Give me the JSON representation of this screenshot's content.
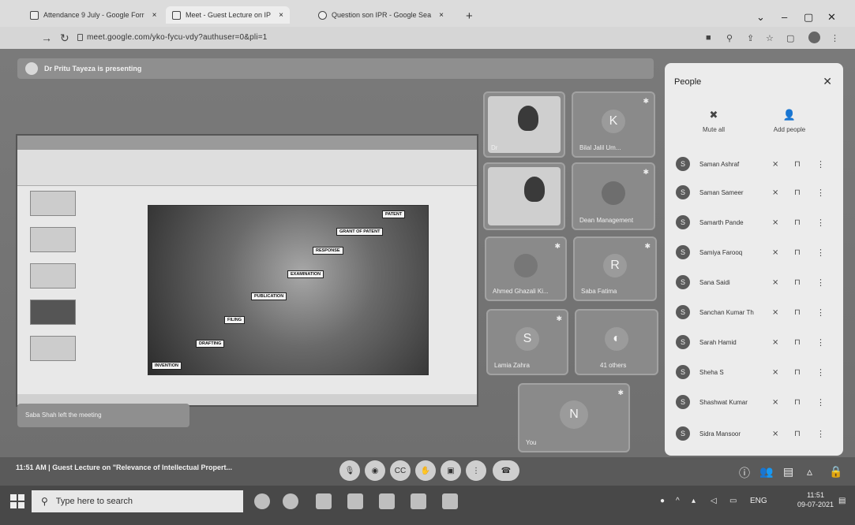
{
  "browser": {
    "tabs": [
      {
        "label": "Attendance 9 July - Google Forr"
      },
      {
        "label": "Meet - Guest Lecture on IP"
      },
      {
        "label": "Question son IPR - Google Sea"
      }
    ],
    "url": "meet.google.com/yko-fycu-vdy?authuser=0&pli=1"
  },
  "meet": {
    "presenting_label": "Dr Pritu Tayeza is presenting",
    "slide": {
      "labels": [
        "PATENT",
        "GRANT OF PATENT",
        "RESPONSE",
        "EXAMINATION",
        "PUBLICATION",
        "FILING",
        "DRAFTING",
        "INVENTION"
      ]
    },
    "tiles": [
      {
        "name": "Dr",
        "initial": ""
      },
      {
        "name": "Bilal Jalil Um...",
        "initial": "K"
      },
      {
        "name": "",
        "initial": ""
      },
      {
        "name": "Dean Management",
        "initial": ""
      },
      {
        "name": "Ahmed Ghazali Ki...",
        "initial": ""
      },
      {
        "name": "Saba Fatima",
        "initial": "R"
      },
      {
        "name": "Lamia Zahra",
        "initial": "S"
      },
      {
        "name": "41 others",
        "initial": ""
      },
      {
        "name": "You",
        "initial": "N"
      }
    ],
    "left_notice": "Saba Shah left the meeting",
    "meeting_info": "11:51 AM  |  Guest Lecture on \"Relevance of Intellectual Propert..."
  },
  "people_panel": {
    "title": "People",
    "mute_all": "Mute all",
    "add_people": "Add people",
    "participants": [
      {
        "name": "Saman Ashraf",
        "initial": "S"
      },
      {
        "name": "Saman Sameer",
        "initial": "S"
      },
      {
        "name": "Samarth Pande",
        "initial": "S"
      },
      {
        "name": "Samiya Farooq",
        "initial": "S"
      },
      {
        "name": "Sana Saidi",
        "initial": "S"
      },
      {
        "name": "Sanchan Kumar Th",
        "initial": "S"
      },
      {
        "name": "Sarah Hamid",
        "initial": "S"
      },
      {
        "name": "Sheha S",
        "initial": "S"
      },
      {
        "name": "Shashwat Kumar",
        "initial": "S"
      },
      {
        "name": "Sidra Mansoor",
        "initial": "S"
      }
    ]
  },
  "taskbar": {
    "search_placeholder": "Type here to search",
    "time": "11:51",
    "date": "09-07-2021"
  }
}
